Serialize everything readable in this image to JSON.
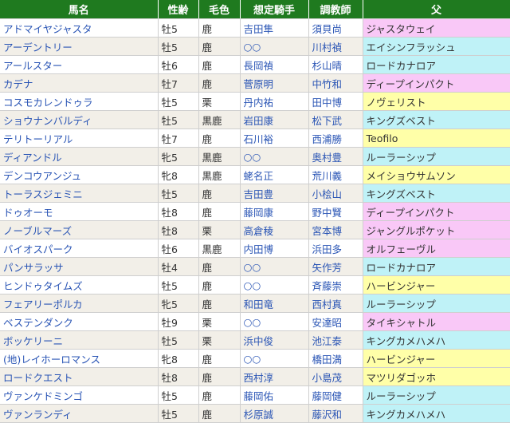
{
  "headers": [
    "馬名",
    "性齢",
    "毛色",
    "想定騎手",
    "調教師",
    "父"
  ],
  "sire_colors": {
    "pink": "#f9c8f7",
    "cyan": "#bff2f7",
    "yellow": "#ffffa8"
  },
  "rows": [
    {
      "name": "アドマイヤジャスタ",
      "sexage": "牡5",
      "color": "鹿",
      "jockey": "吉田隼",
      "trainer": "須貝尚",
      "sire": "ジャスタウェイ",
      "sire_color": "pink"
    },
    {
      "name": "アーデントリー",
      "sexage": "牡5",
      "color": "鹿",
      "jockey": "○○",
      "trainer": "川村禎",
      "sire": "エイシンフラッシュ",
      "sire_color": "cyan"
    },
    {
      "name": "アールスター",
      "sexage": "牡6",
      "color": "鹿",
      "jockey": "長岡禎",
      "trainer": "杉山晴",
      "sire": "ロードカナロア",
      "sire_color": "cyan"
    },
    {
      "name": "カデナ",
      "sexage": "牡7",
      "color": "鹿",
      "jockey": "菅原明",
      "trainer": "中竹和",
      "sire": "ディープインパクト",
      "sire_color": "pink"
    },
    {
      "name": "コスモカレンドゥラ",
      "sexage": "牡5",
      "color": "栗",
      "jockey": "丹内祐",
      "trainer": "田中博",
      "sire": "ノヴェリスト",
      "sire_color": "yellow"
    },
    {
      "name": "ショウナンバルディ",
      "sexage": "牡5",
      "color": "黒鹿",
      "jockey": "岩田康",
      "trainer": "松下武",
      "sire": "キングズベスト",
      "sire_color": "cyan"
    },
    {
      "name": "テリトーリアル",
      "sexage": "牡7",
      "color": "鹿",
      "jockey": "石川裕",
      "trainer": "西浦勝",
      "sire": "Teofilo",
      "sire_color": "yellow"
    },
    {
      "name": "ディアンドル",
      "sexage": "牝5",
      "color": "黒鹿",
      "jockey": "○○",
      "trainer": "奥村豊",
      "sire": "ルーラーシップ",
      "sire_color": "cyan"
    },
    {
      "name": "デンコウアンジュ",
      "sexage": "牝8",
      "color": "黒鹿",
      "jockey": "蛯名正",
      "trainer": "荒川義",
      "sire": "メイショウサムソン",
      "sire_color": "yellow"
    },
    {
      "name": "トーラスジェミニ",
      "sexage": "牡5",
      "color": "鹿",
      "jockey": "吉田豊",
      "trainer": "小桧山",
      "sire": "キングズベスト",
      "sire_color": "cyan"
    },
    {
      "name": "ドゥオーモ",
      "sexage": "牡8",
      "color": "鹿",
      "jockey": "藤岡康",
      "trainer": "野中賢",
      "sire": "ディープインパクト",
      "sire_color": "pink"
    },
    {
      "name": "ノーブルマーズ",
      "sexage": "牡8",
      "color": "栗",
      "jockey": "高倉稜",
      "trainer": "宮本博",
      "sire": "ジャングルポケット",
      "sire_color": "pink"
    },
    {
      "name": "バイオスパーク",
      "sexage": "牡6",
      "color": "黒鹿",
      "jockey": "内田博",
      "trainer": "浜田多",
      "sire": "オルフェーヴル",
      "sire_color": "pink"
    },
    {
      "name": "パンサラッサ",
      "sexage": "牡4",
      "color": "鹿",
      "jockey": "○○",
      "trainer": "矢作芳",
      "sire": "ロードカナロア",
      "sire_color": "cyan"
    },
    {
      "name": "ヒンドゥタイムズ",
      "sexage": "牡5",
      "color": "鹿",
      "jockey": "○○",
      "trainer": "斉藤崇",
      "sire": "ハービンジャー",
      "sire_color": "yellow"
    },
    {
      "name": "フェアリーポルカ",
      "sexage": "牝5",
      "color": "鹿",
      "jockey": "和田竜",
      "trainer": "西村真",
      "sire": "ルーラーシップ",
      "sire_color": "cyan"
    },
    {
      "name": "ベステンダンク",
      "sexage": "牡9",
      "color": "栗",
      "jockey": "○○",
      "trainer": "安達昭",
      "sire": "タイキシャトル",
      "sire_color": "pink"
    },
    {
      "name": "ボッケリーニ",
      "sexage": "牡5",
      "color": "栗",
      "jockey": "浜中俊",
      "trainer": "池江泰",
      "sire": "キングカメハメハ",
      "sire_color": "cyan"
    },
    {
      "name": "(地)レイホーロマンス",
      "sexage": "牝8",
      "color": "鹿",
      "jockey": "○○",
      "trainer": "橋田満",
      "sire": "ハービンジャー",
      "sire_color": "yellow"
    },
    {
      "name": "ロードクエスト",
      "sexage": "牡8",
      "color": "鹿",
      "jockey": "西村淳",
      "trainer": "小島茂",
      "sire": "マツリダゴッホ",
      "sire_color": "yellow"
    },
    {
      "name": "ヴァンケドミンゴ",
      "sexage": "牡5",
      "color": "鹿",
      "jockey": "藤岡佑",
      "trainer": "藤岡健",
      "sire": "ルーラーシップ",
      "sire_color": "cyan"
    },
    {
      "name": "ヴァンランディ",
      "sexage": "牡5",
      "color": "鹿",
      "jockey": "杉原誠",
      "trainer": "藤沢和",
      "sire": "キングカメハメハ",
      "sire_color": "cyan"
    }
  ]
}
